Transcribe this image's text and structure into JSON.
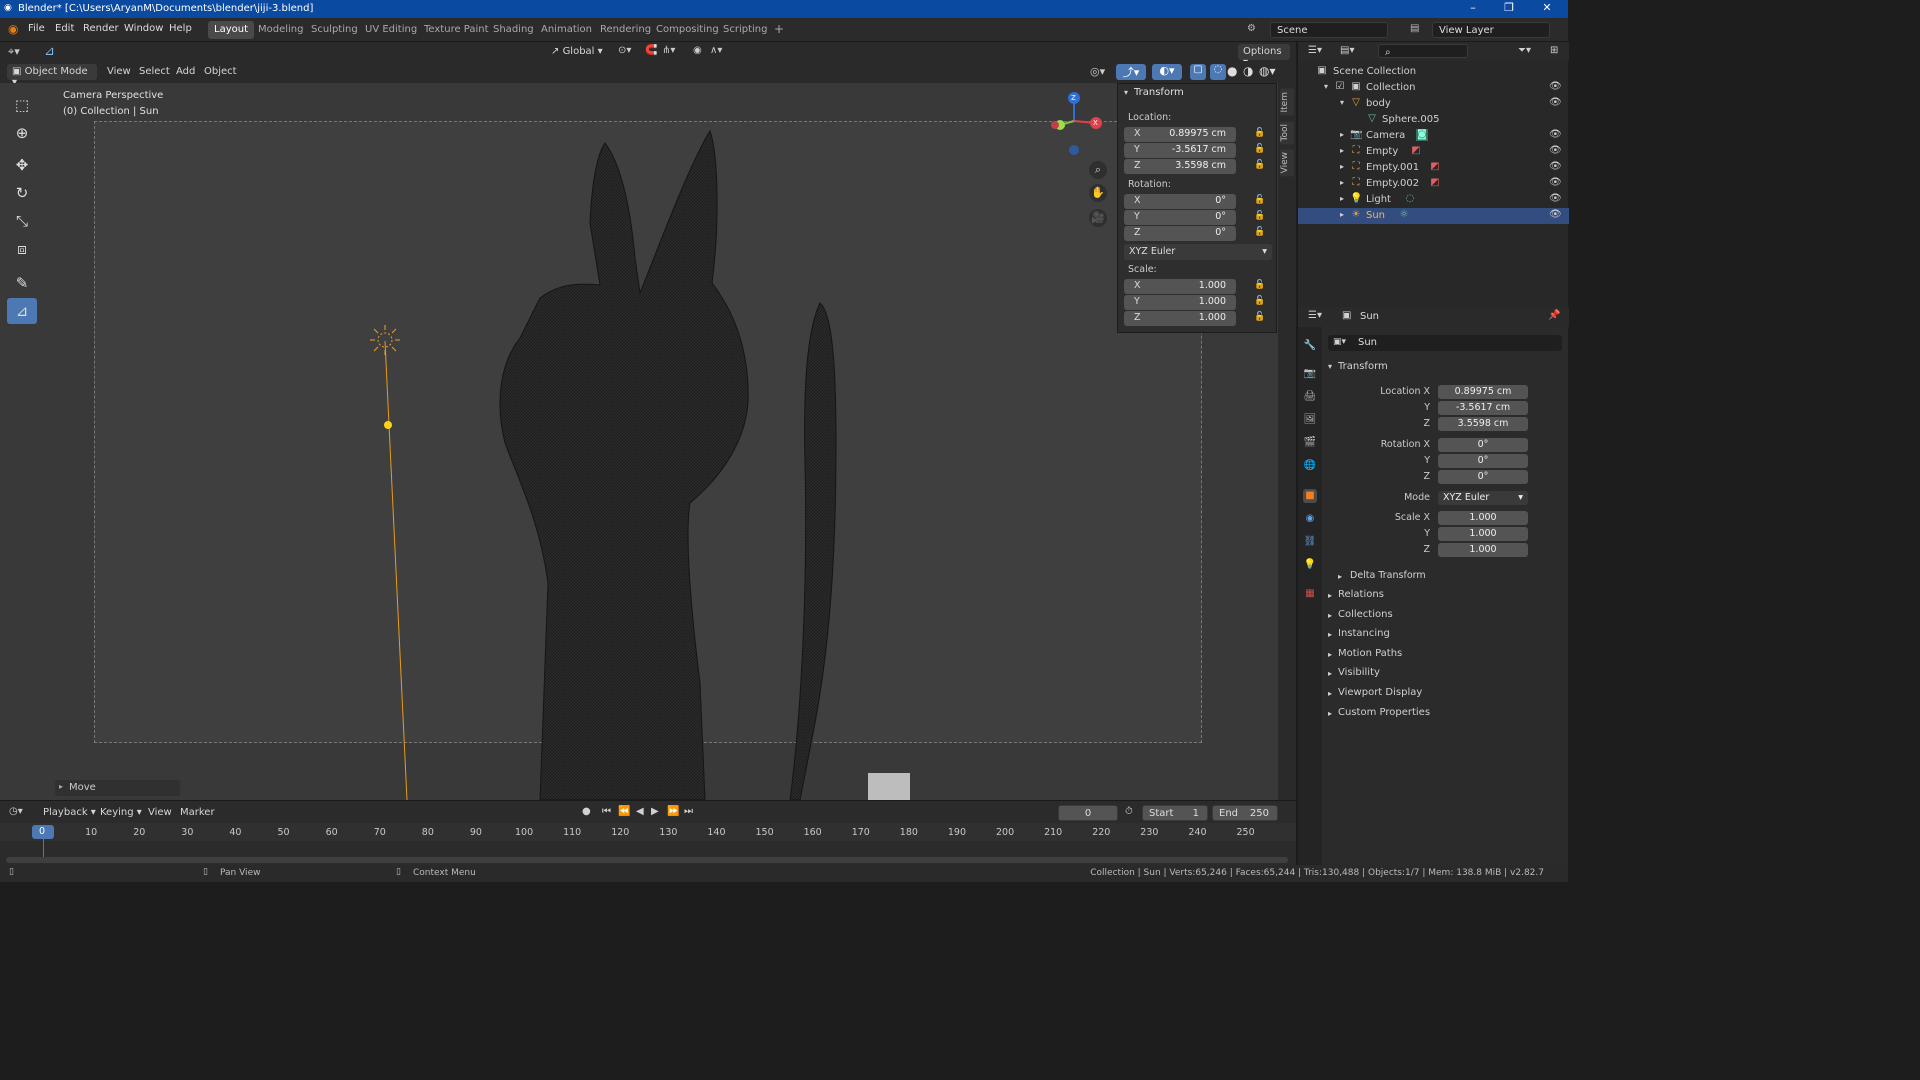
{
  "window": {
    "title": "Blender* [C:\\Users\\AryanM\\Documents\\blender\\jiji-3.blend]",
    "controls": [
      "–",
      "❐",
      "✕"
    ]
  },
  "menus": [
    "File",
    "Edit",
    "Render",
    "Window",
    "Help"
  ],
  "workspaces": [
    {
      "label": "Layout",
      "active": true
    },
    {
      "label": "Modeling"
    },
    {
      "label": "Sculpting"
    },
    {
      "label": "UV Editing"
    },
    {
      "label": "Texture Paint"
    },
    {
      "label": "Shading"
    },
    {
      "label": "Animation"
    },
    {
      "label": "Rendering"
    },
    {
      "label": "Compositing"
    },
    {
      "label": "Scripting"
    }
  ],
  "add_workspace": "+",
  "scene": {
    "name": "Scene",
    "view_layer": "View Layer"
  },
  "viewport_header": {
    "transform_orientation": "Global",
    "options": "Options",
    "mode": "Object Mode",
    "menus": [
      "View",
      "Select",
      "Add",
      "Object"
    ]
  },
  "viewport": {
    "camera_label": "Camera Perspective",
    "collection_label": "(0) Collection | Sun",
    "last_op": "Move",
    "gizmo_axes": {
      "x": "X",
      "y": "Y",
      "z": "Z"
    }
  },
  "npanel": {
    "header": "Transform",
    "location_label": "Location:",
    "location": [
      {
        "k": "X",
        "v": "0.89975 cm"
      },
      {
        "k": "Y",
        "v": "-3.5617 cm"
      },
      {
        "k": "Z",
        "v": "3.5598 cm"
      }
    ],
    "rotation_label": "Rotation:",
    "rotation": [
      {
        "k": "X",
        "v": "0°"
      },
      {
        "k": "Y",
        "v": "0°"
      },
      {
        "k": "Z",
        "v": "0°"
      }
    ],
    "rotation_mode": "XYZ Euler",
    "scale_label": "Scale:",
    "scale": [
      {
        "k": "X",
        "v": "1.000"
      },
      {
        "k": "Y",
        "v": "1.000"
      },
      {
        "k": "Z",
        "v": "1.000"
      }
    ],
    "tabs": [
      "Item",
      "Tool",
      "View"
    ]
  },
  "outliner": {
    "root": "Scene Collection",
    "items": [
      {
        "label": "Collection",
        "indent": 1
      },
      {
        "label": "body",
        "indent": 2
      },
      {
        "label": "Sphere.005",
        "indent": 3
      },
      {
        "label": "Camera",
        "indent": 2
      },
      {
        "label": "Empty",
        "indent": 2
      },
      {
        "label": "Empty.001",
        "indent": 2
      },
      {
        "label": "Empty.002",
        "indent": 2
      },
      {
        "label": "Light",
        "indent": 2
      },
      {
        "label": "Sun",
        "indent": 2,
        "selected": true
      }
    ]
  },
  "properties": {
    "object_name": "Sun",
    "datablock": "Sun",
    "transform_header": "Transform",
    "location_x_label": "Location X",
    "rotation_x_label": "Rotation X",
    "scale_x_label": "Scale X",
    "mode_label": "Mode",
    "y_label": "Y",
    "z_label": "Z",
    "location": [
      "0.89975 cm",
      "-3.5617 cm",
      "3.5598 cm"
    ],
    "rotation": [
      "0°",
      "0°",
      "0°"
    ],
    "mode": "XYZ Euler",
    "scale": [
      "1.000",
      "1.000",
      "1.000"
    ],
    "delta": "Delta Transform",
    "sections": [
      "Relations",
      "Collections",
      "Instancing",
      "Motion Paths",
      "Visibility",
      "Viewport Display",
      "Custom Properties"
    ]
  },
  "timeline": {
    "menus": [
      "Playback",
      "Keying",
      "View",
      "Marker"
    ],
    "current_frame": "0",
    "start_label": "Start",
    "start": "1",
    "end_label": "End",
    "end": "250",
    "ticks": [
      "0",
      "10",
      "20",
      "30",
      "40",
      "50",
      "60",
      "70",
      "80",
      "90",
      "100",
      "110",
      "120",
      "130",
      "140",
      "150",
      "160",
      "170",
      "180",
      "190",
      "200",
      "210",
      "220",
      "230",
      "240",
      "250"
    ]
  },
  "statusbar": {
    "pan": "Pan View",
    "context": "Context Menu",
    "stats": "Collection | Sun | Verts:65,246 | Faces:65,244 | Tris:130,488 | Objects:1/7 | Mem: 138.8 MiB | v2.82.7"
  }
}
